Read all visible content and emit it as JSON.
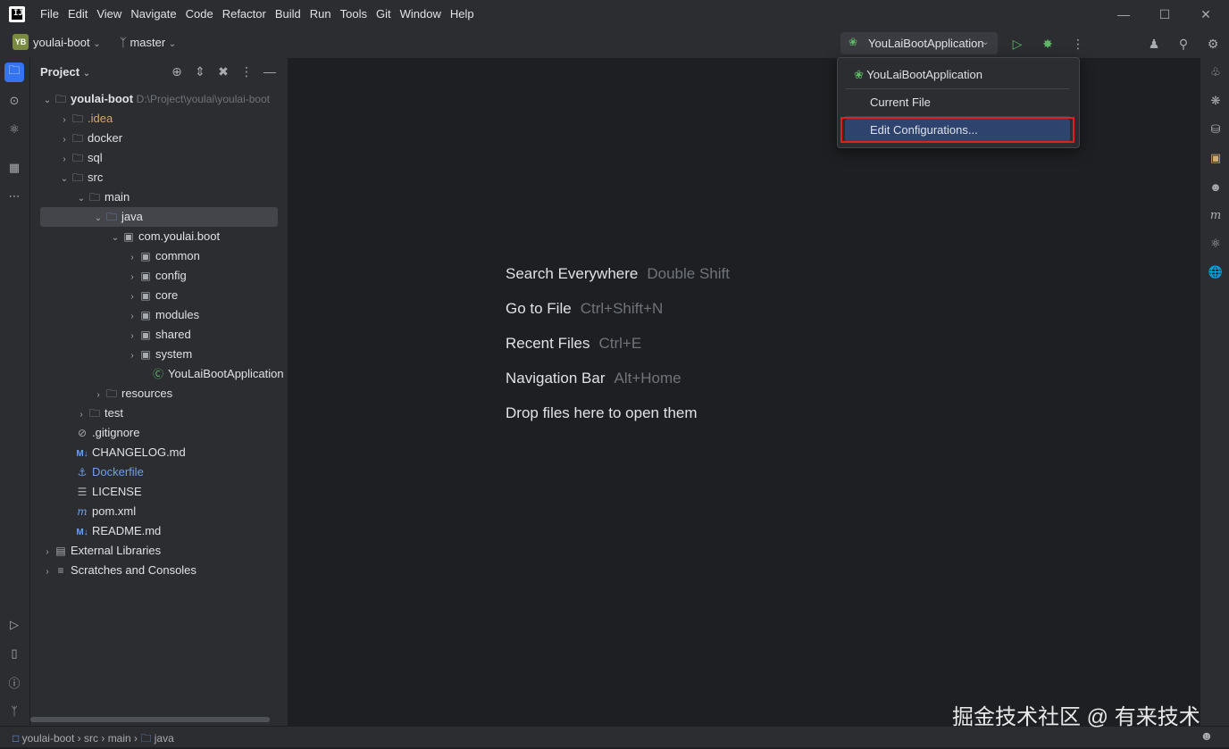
{
  "menu": [
    "File",
    "Edit",
    "View",
    "Navigate",
    "Code",
    "Refactor",
    "Build",
    "Run",
    "Tools",
    "Git",
    "Window",
    "Help"
  ],
  "logo_text": "IJ",
  "toolbar": {
    "project_badge": "YB",
    "project_name": "youlai-boot",
    "branch_name": "master",
    "run_config": "YouLaiBootApplication"
  },
  "panel": {
    "title": "Project"
  },
  "tree": {
    "root_name": "youlai-boot",
    "root_path": "D:\\Project\\youlai\\youlai-boot",
    "idea": ".idea",
    "docker": "docker",
    "sql": "sql",
    "src": "src",
    "main": "main",
    "java": "java",
    "pkg": "com.youlai.boot",
    "common": "common",
    "config": "config",
    "core": "core",
    "modules": "modules",
    "shared": "shared",
    "system": "system",
    "app": "YouLaiBootApplication",
    "resources": "resources",
    "test": "test",
    "gitignore": ".gitignore",
    "changelog": "CHANGELOG.md",
    "dockerfile": "Dockerfile",
    "license": "LICENSE",
    "pom": "pom.xml",
    "readme": "README.md",
    "ext_libs": "External Libraries",
    "scratches": "Scratches and Consoles"
  },
  "editor_hints": [
    {
      "label": "Search Everywhere",
      "shortcut": "Double Shift"
    },
    {
      "label": "Go to File",
      "shortcut": "Ctrl+Shift+N"
    },
    {
      "label": "Recent Files",
      "shortcut": "Ctrl+E"
    },
    {
      "label": "Navigation Bar",
      "shortcut": "Alt+Home"
    },
    {
      "label": "Drop files here to open them",
      "shortcut": ""
    }
  ],
  "popup": {
    "item1": "YouLaiBootApplication",
    "item2": "Current File",
    "item3": "Edit Configurations..."
  },
  "statusbar": {
    "crumb1": "youlai-boot",
    "crumb2": "src",
    "crumb3": "main",
    "crumb4": "java"
  },
  "watermark": "掘金技术社区 @ 有来技术",
  "colors": {
    "accent": "#3574f0",
    "selection": "#2e436e",
    "highlight_border": "#e02020",
    "run_green": "#5fb865"
  }
}
